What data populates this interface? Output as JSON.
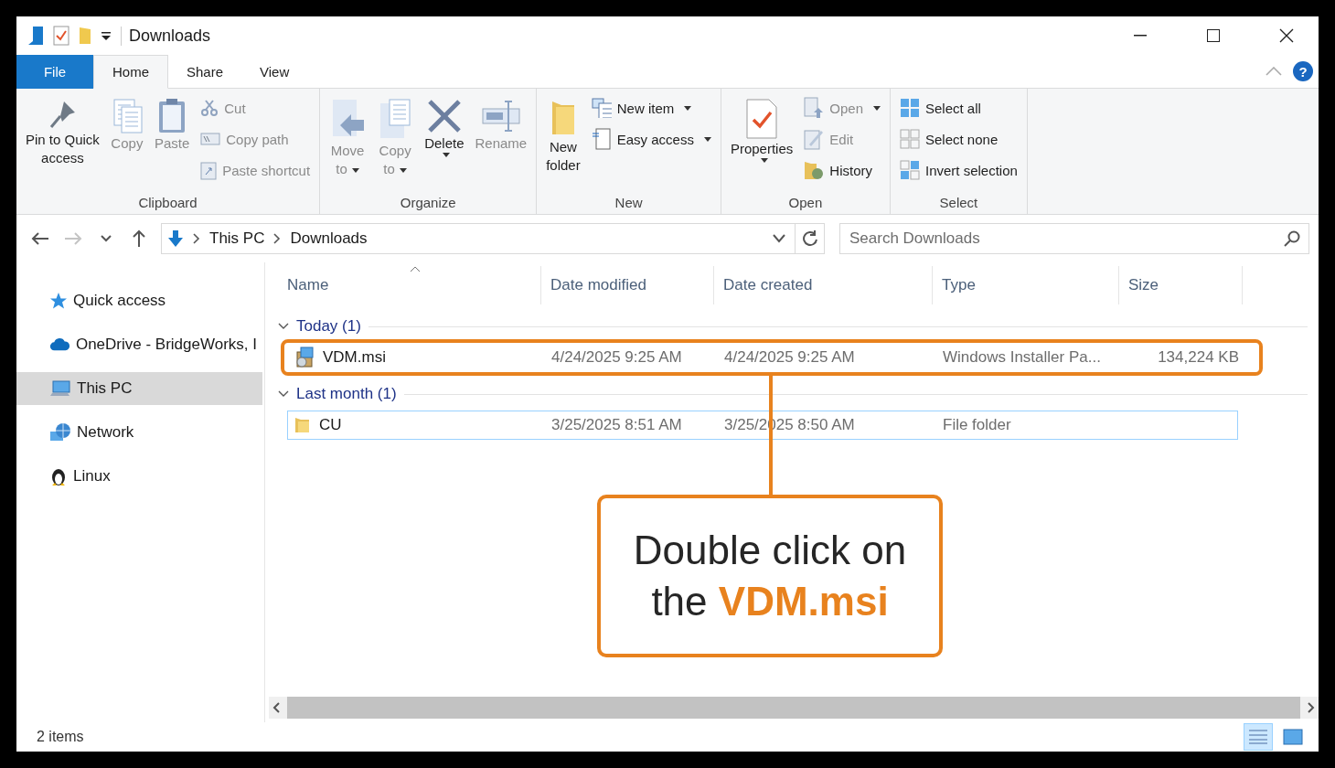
{
  "window": {
    "title": "Downloads"
  },
  "ribbon_tabs": [
    {
      "label": "File",
      "kind": "file",
      "selected": false
    },
    {
      "label": "Home",
      "kind": "tab",
      "selected": true
    },
    {
      "label": "Share",
      "kind": "tab",
      "selected": false
    },
    {
      "label": "View",
      "kind": "tab",
      "selected": false
    }
  ],
  "help_label": "?",
  "ribbon_groups": [
    {
      "label": "Clipboard",
      "columns": [
        [
          {
            "lines": [
              "Pin to Quick",
              "access"
            ],
            "kind": "large",
            "disabled": false,
            "dropdown": false
          }
        ],
        [
          {
            "lines": [
              "Copy"
            ],
            "kind": "large",
            "disabled": true,
            "dropdown": false
          }
        ],
        [
          {
            "lines": [
              "Paste"
            ],
            "kind": "large",
            "disabled": true,
            "dropdown": false
          }
        ],
        [
          {
            "lines": [
              "Cut"
            ],
            "kind": "small",
            "disabled": true,
            "dropdown": false
          },
          {
            "lines": [
              "Copy path"
            ],
            "kind": "small",
            "disabled": true,
            "dropdown": false
          },
          {
            "lines": [
              "Paste shortcut"
            ],
            "kind": "small",
            "disabled": true,
            "dropdown": false
          }
        ]
      ]
    },
    {
      "label": "Organize",
      "columns": [
        [
          {
            "lines": [
              "Move",
              "to"
            ],
            "kind": "large",
            "disabled": true,
            "dropdown": true
          }
        ],
        [
          {
            "lines": [
              "Copy",
              "to"
            ],
            "kind": "large",
            "disabled": true,
            "dropdown": true
          }
        ],
        [
          {
            "lines": [
              "Delete"
            ],
            "kind": "large",
            "disabled": false,
            "dropdown": true
          }
        ],
        [
          {
            "lines": [
              "Rename"
            ],
            "kind": "large",
            "disabled": true,
            "dropdown": false
          }
        ]
      ]
    },
    {
      "label": "New",
      "columns": [
        [
          {
            "lines": [
              "New",
              "folder"
            ],
            "kind": "large",
            "disabled": false,
            "dropdown": false
          }
        ],
        [
          {
            "lines": [
              "New item"
            ],
            "kind": "small",
            "disabled": false,
            "dropdown": true
          },
          {
            "lines": [
              "Easy access"
            ],
            "kind": "small",
            "disabled": false,
            "dropdown": true
          }
        ]
      ]
    },
    {
      "label": "Open",
      "columns": [
        [
          {
            "lines": [
              "Properties"
            ],
            "kind": "large",
            "disabled": false,
            "dropdown": true
          }
        ],
        [
          {
            "lines": [
              "Open"
            ],
            "kind": "small",
            "disabled": true,
            "dropdown": true
          },
          {
            "lines": [
              "Edit"
            ],
            "kind": "small",
            "disabled": true,
            "dropdown": false
          },
          {
            "lines": [
              "History"
            ],
            "kind": "small",
            "disabled": false,
            "dropdown": false
          }
        ]
      ]
    },
    {
      "label": "Select",
      "columns": [
        [
          {
            "lines": [
              "Select all"
            ],
            "kind": "small",
            "disabled": false,
            "dropdown": false
          },
          {
            "lines": [
              "Select none"
            ],
            "kind": "small",
            "disabled": false,
            "dropdown": false
          },
          {
            "lines": [
              "Invert selection"
            ],
            "kind": "small",
            "disabled": false,
            "dropdown": false
          }
        ]
      ]
    }
  ],
  "address_bar": {
    "crumbs": [
      "This PC",
      "Downloads"
    ]
  },
  "search": {
    "placeholder": "Search Downloads"
  },
  "nav_buttons": [
    {
      "kind": "back",
      "disabled": false
    },
    {
      "kind": "forward",
      "disabled": true
    },
    {
      "kind": "recent",
      "disabled": false
    },
    {
      "kind": "up",
      "disabled": false
    }
  ],
  "sidebar": {
    "items": [
      {
        "label": "Quick access",
        "kind": "star",
        "selected": false
      },
      {
        "label": "OneDrive - BridgeWorks, I",
        "kind": "cloud",
        "selected": false
      },
      {
        "label": "This PC",
        "kind": "pc",
        "selected": true
      },
      {
        "label": "Network",
        "kind": "network",
        "selected": false
      },
      {
        "label": "Linux",
        "kind": "penguin",
        "selected": false
      }
    ]
  },
  "table": {
    "columns": [
      {
        "label": "Name",
        "sorted": true
      },
      {
        "label": "Date modified",
        "sorted": false
      },
      {
        "label": "Date created",
        "sorted": false
      },
      {
        "label": "Type",
        "sorted": false
      },
      {
        "label": "Size",
        "sorted": false
      }
    ],
    "groups": [
      {
        "label": "Today (1)",
        "expanded": true,
        "rows": [
          {
            "name": "VDM.msi",
            "kind": "installer",
            "modified": "4/24/2025 9:25 AM",
            "created": "4/24/2025 9:25 AM",
            "type": "Windows Installer Pa...",
            "size": "134,224 KB",
            "focused": false
          }
        ]
      },
      {
        "label": "Last month (1)",
        "expanded": true,
        "rows": [
          {
            "name": "CU",
            "kind": "folder",
            "modified": "3/25/2025 8:51 AM",
            "created": "3/25/2025 8:50 AM",
            "type": "File folder",
            "focused": true
          }
        ]
      }
    ]
  },
  "status_bar": {
    "text": "2 items",
    "views": [
      {
        "kind": "details",
        "selected": true
      },
      {
        "kind": "large-icons",
        "selected": false
      }
    ]
  },
  "callout": {
    "text": "Double click on the **VDM.msi**"
  }
}
